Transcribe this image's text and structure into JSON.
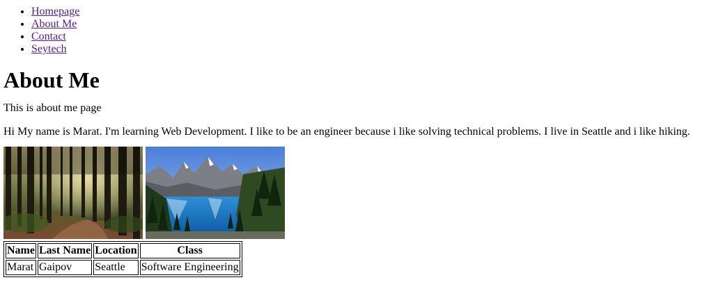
{
  "nav": {
    "items": [
      {
        "label": "Homepage"
      },
      {
        "label": "About Me"
      },
      {
        "label": "Contact"
      },
      {
        "label": "Seytech"
      }
    ]
  },
  "page": {
    "title": "About Me",
    "subtitle": "This is about me page",
    "bio": "Hi My name is Marat. I'm learning Web Development. I like to be an engineer because i like solving technical problems. I live in Seattle and i like hiking."
  },
  "table": {
    "headers": [
      "Name",
      "Last Name",
      "Location",
      "Class"
    ],
    "rows": [
      [
        "Marat",
        "Gaipov",
        "Seattle",
        "Software Engineering"
      ]
    ]
  },
  "colors": {
    "link": "#551a8b",
    "text": "#000000",
    "background": "#ffffff"
  }
}
